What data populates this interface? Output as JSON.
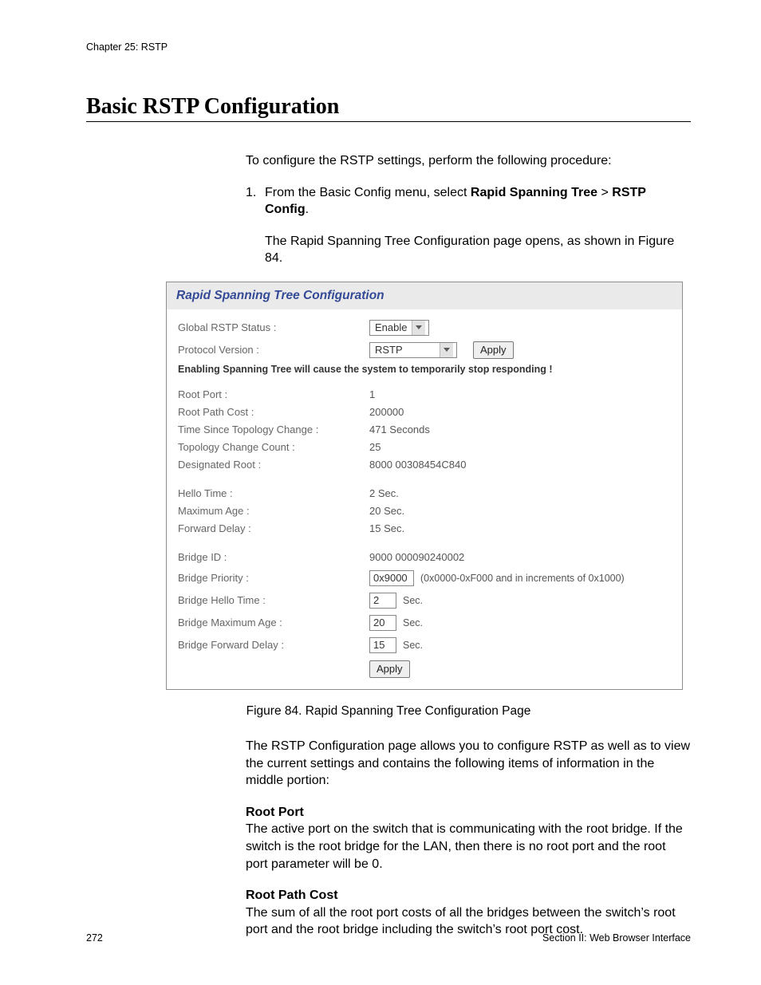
{
  "header": {
    "running": "Chapter 25: RSTP"
  },
  "title": "Basic RSTP Configuration",
  "intro": "To configure the RSTP settings, perform the following procedure:",
  "step1": {
    "num": "1.",
    "pre": "From the Basic Config menu, select ",
    "bold1": "Rapid Spanning Tree",
    "sep": " > ",
    "bold2": "RSTP Config",
    "post": "."
  },
  "step1_result": "The Rapid Spanning Tree Configuration page opens, as shown in Figure 84.",
  "shot": {
    "title": "Rapid Spanning Tree Configuration",
    "globalStatus": {
      "label": "Global RSTP Status :",
      "value": "Enable"
    },
    "protocol": {
      "label": "Protocol Version :",
      "value": "RSTP",
      "apply": "Apply"
    },
    "warning": "Enabling Spanning Tree will cause the system to temporarily stop responding !",
    "ro": {
      "rootPort": {
        "label": "Root Port :",
        "value": "1"
      },
      "rootPathCost": {
        "label": "Root Path Cost :",
        "value": "200000"
      },
      "topoChange": {
        "label": "Time Since Topology Change :",
        "value": "471 Seconds"
      },
      "topoCount": {
        "label": "Topology Change Count :",
        "value": "25"
      },
      "desigRoot": {
        "label": "Designated Root :",
        "value": "8000 00308454C840"
      },
      "hello": {
        "label": "Hello Time :",
        "value": "2 Sec."
      },
      "maxAge": {
        "label": "Maximum Age :",
        "value": "20 Sec."
      },
      "fwdDelay": {
        "label": "Forward Delay :",
        "value": "15 Sec."
      }
    },
    "cfg": {
      "bridgeId": {
        "label": "Bridge ID :",
        "value": "9000 000090240002"
      },
      "bridgePriority": {
        "label": "Bridge Priority :",
        "value": "0x9000",
        "hint": "(0x0000-0xF000 and in increments of 0x1000)"
      },
      "bridgeHello": {
        "label": "Bridge Hello Time :",
        "value": "2",
        "unit": "Sec."
      },
      "bridgeMaxAge": {
        "label": "Bridge Maximum Age :",
        "value": "20",
        "unit": "Sec."
      },
      "bridgeFwd": {
        "label": "Bridge Forward Delay :",
        "value": "15",
        "unit": "Sec."
      },
      "apply": "Apply"
    }
  },
  "figureCaption": "Figure 84. Rapid Spanning Tree Configuration Page",
  "afterFigure": "The RSTP Configuration page allows you to configure RSTP as well as to view the current settings and contains the following items of information in the middle portion:",
  "rootPort": {
    "heading": "Root Port",
    "body": "The active port on the switch that is communicating with the root bridge. If the switch is the root bridge for the LAN, then there is no root port and the root port parameter will be 0."
  },
  "rootPathCost": {
    "heading": "Root Path Cost",
    "body": "The sum of all the root port costs of all the bridges between the switch’s root port and the root bridge including the switch’s root port cost."
  },
  "footer": {
    "pageNum": "272",
    "section": "Section II: Web Browser Interface"
  }
}
